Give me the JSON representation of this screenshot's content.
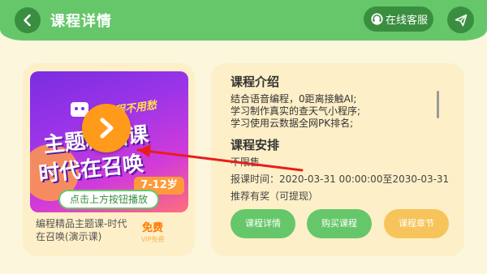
{
  "header": {
    "title": "课程详情",
    "service_label": "在线客服",
    "bg_color": "#66c76a",
    "button_color": "#3a8e3f"
  },
  "poster": {
    "slogan": "学编程不用愁",
    "line1": "主题精品课",
    "line2": "时代在召唤",
    "age": "7-12岁",
    "play_hint": "点击上方按钮播放"
  },
  "course": {
    "name": "编程精品主题课-时代在召唤(演示课)",
    "price": "免费",
    "vip": "VIP免费"
  },
  "intro": {
    "title": "课程介绍",
    "lines": [
      "结合语音编程，0距离接触AI;",
      "学习制作真实的查天气小程序;",
      "学习使用云数据全网PK排名;"
    ]
  },
  "plan": {
    "title": "课程安排",
    "status": "不限售",
    "time": "报课时间：2020-03-31 00:00:00至2030-03-31",
    "reward": "推荐有奖（可提现）"
  },
  "actions": {
    "detail": "课程详情",
    "buy": "购买课程",
    "chapters": "课程章节"
  },
  "colors": {
    "accent_green": "#66c76a",
    "accent_orange": "#f6c45a",
    "price_orange": "#ff7a00",
    "page_bg": "#fbf6dc",
    "card_bg": "#fdefc7",
    "annotation_red": "#e61e1e"
  },
  "icons": {
    "back": "chevron-left-icon",
    "service": "headset-icon",
    "send": "paper-plane-icon",
    "play": "play-icon"
  }
}
